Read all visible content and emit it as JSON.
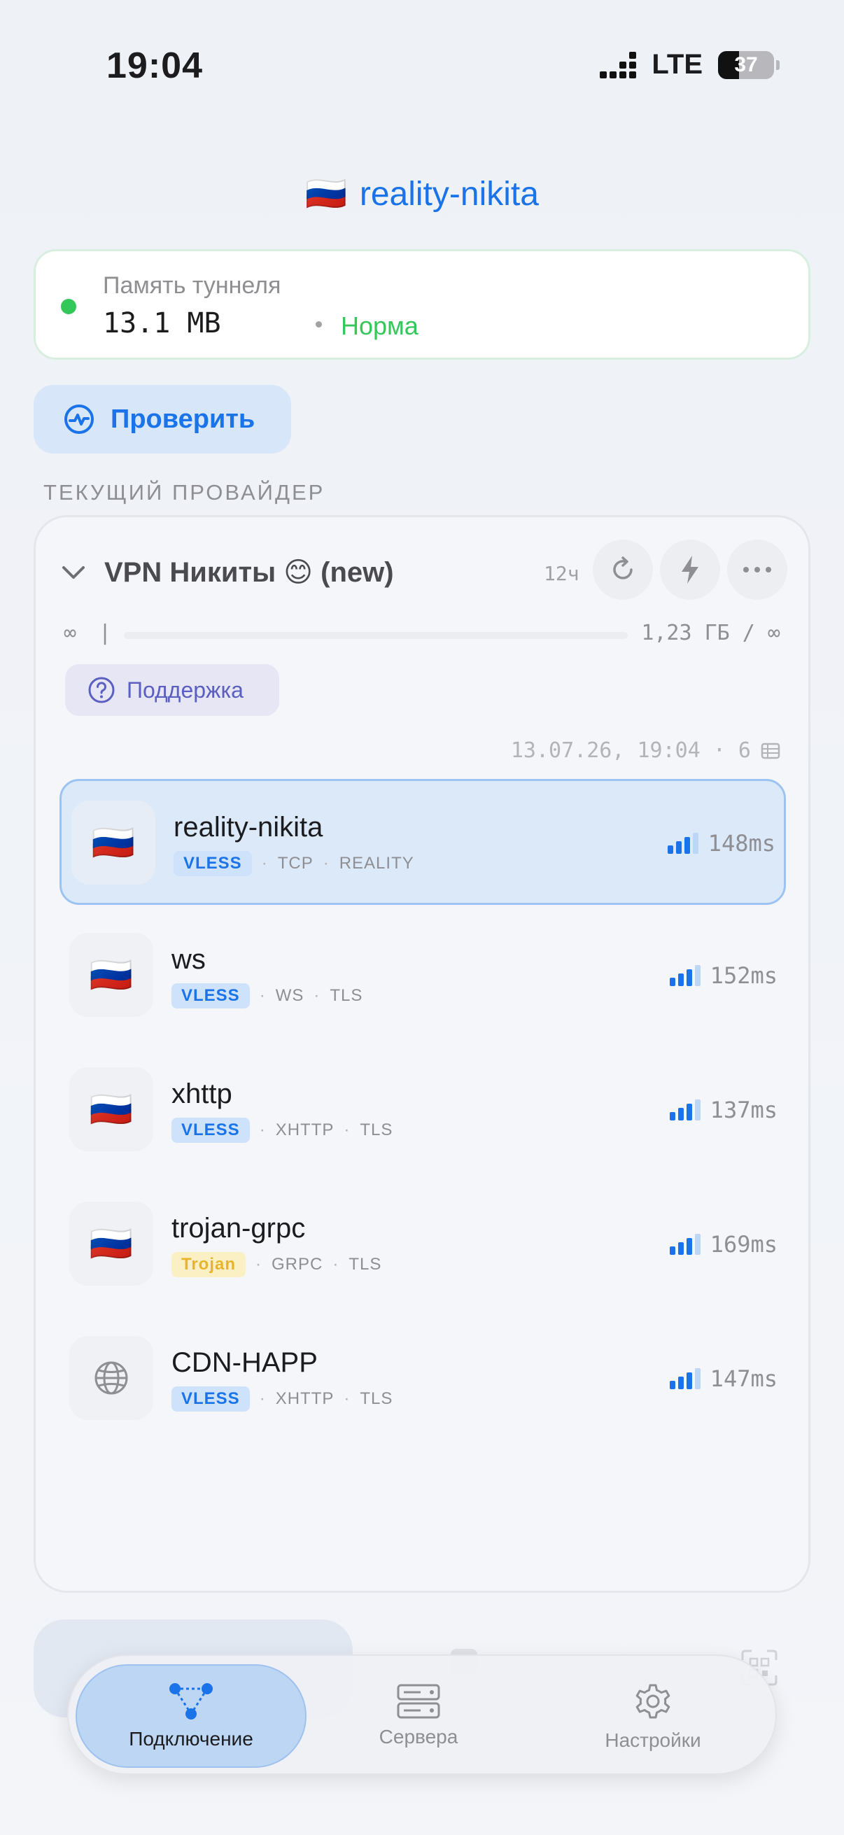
{
  "status_bar": {
    "time": "19:04",
    "network": "LTE",
    "battery": "37"
  },
  "header": {
    "flag": "🇷🇺",
    "title": "reality-nikita"
  },
  "memory": {
    "label": "Память туннеля",
    "value": "13.1 MB",
    "status": "Норма"
  },
  "check_button": {
    "label": "Проверить"
  },
  "section_label": "ТЕКУЩИЙ ПРОВАЙДЕР",
  "provider": {
    "name": "VPN Никиты 😊 (new)",
    "interval": "12ч",
    "usage_left": "∞",
    "usage_sep": "|",
    "usage_text": "1,23 ГБ / ∞",
    "usage_fraction": 0,
    "support_label": "Поддержка",
    "updated": "13.07.26, 19:04 · 6"
  },
  "servers": [
    {
      "name": "reality-nikita",
      "icon": "🇷🇺",
      "protocol": "VLESS",
      "transport": "TCP",
      "security": "REALITY",
      "ping": "148ms",
      "active": true
    },
    {
      "name": "ws",
      "icon": "🇷🇺",
      "protocol": "VLESS",
      "transport": "WS",
      "security": "TLS",
      "ping": "152ms",
      "active": false
    },
    {
      "name": "xhttp",
      "icon": "🇷🇺",
      "protocol": "VLESS",
      "transport": "XHTTP",
      "security": "TLS",
      "ping": "137ms",
      "active": false
    },
    {
      "name": "trojan-grpc",
      "icon": "🇷🇺",
      "protocol": "Trojan",
      "transport": "GRPC",
      "security": "TLS",
      "ping": "169ms",
      "active": false
    },
    {
      "name": "CDN-HAPP",
      "icon": "globe-icon",
      "protocol": "VLESS",
      "transport": "XHTTP",
      "security": "TLS",
      "ping": "147ms",
      "active": false
    }
  ],
  "tabs": [
    {
      "label": "Подключение",
      "icon": "nodes-icon",
      "active": true
    },
    {
      "label": "Сервера",
      "icon": "servers-icon",
      "active": false
    },
    {
      "label": "Настройки",
      "icon": "gear-icon",
      "active": false
    }
  ],
  "colors": {
    "accent": "#1a73e8",
    "ok": "#34c759",
    "trojan": "#e7b52c"
  }
}
